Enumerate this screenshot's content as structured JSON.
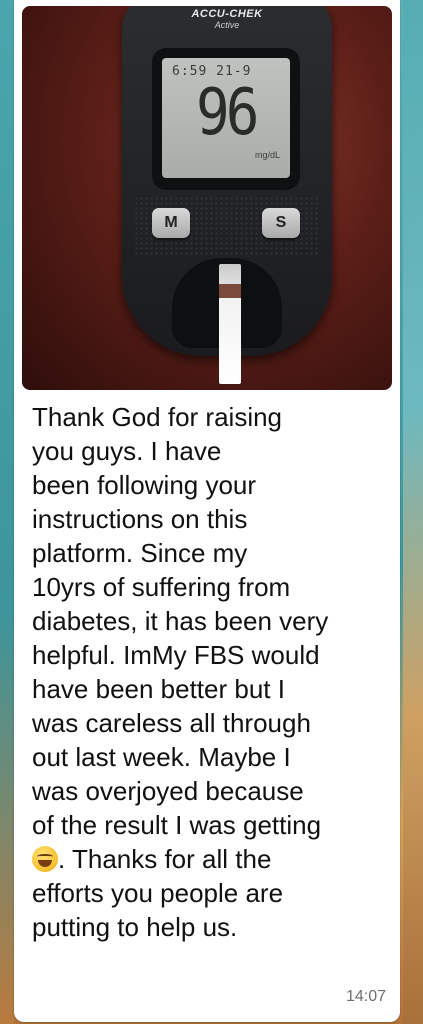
{
  "photo": {
    "brand": "ACCU-CHEK",
    "model": "Active",
    "screen_time": "6:59",
    "screen_date": "21-9",
    "reading_value": "96",
    "reading_unit": "mg/dL",
    "button_m": "M",
    "button_s": "S"
  },
  "message": {
    "text_part1": "Thank God for raising\nyou guys. I have\nbeen following your\ninstructions on this\nplatform. Since my\n10yrs of suffering from\ndiabetes, it has been very\nhelpful. ImMy FBS would\nhave been better but I\nwas careless all through\nout last week. Maybe I\nwas overjoyed because\nof the result I was getting\n",
    "emoji": "grinning-squinting-face-emoji",
    "text_part2": ". Thanks for all the\nefforts you people are\nputting to help us.",
    "timestamp": "14:07"
  },
  "colors": {
    "bubble": "#ffffff",
    "wallpaper": "#3f9aa0",
    "text": "#111111",
    "timestamp": "#6f6f6f"
  }
}
